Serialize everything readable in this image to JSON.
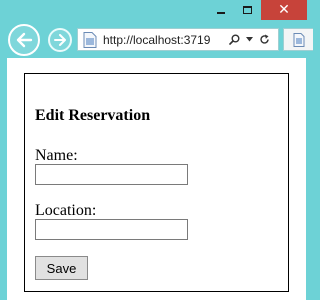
{
  "browser": {
    "url": "http://localhost:3719",
    "icons": {
      "back": "back-arrow-icon",
      "forward": "forward-arrow-icon",
      "page": "page-icon",
      "search": "search-icon",
      "dropdown": "dropdown-icon",
      "refresh": "refresh-icon",
      "minimize": "minimize-icon",
      "maximize": "maximize-icon",
      "close": "close-icon"
    },
    "close_glyph": "✕"
  },
  "form": {
    "title": "Edit Reservation",
    "name_label": "Name:",
    "name_value": "",
    "location_label": "Location:",
    "location_value": "",
    "save_label": "Save"
  }
}
